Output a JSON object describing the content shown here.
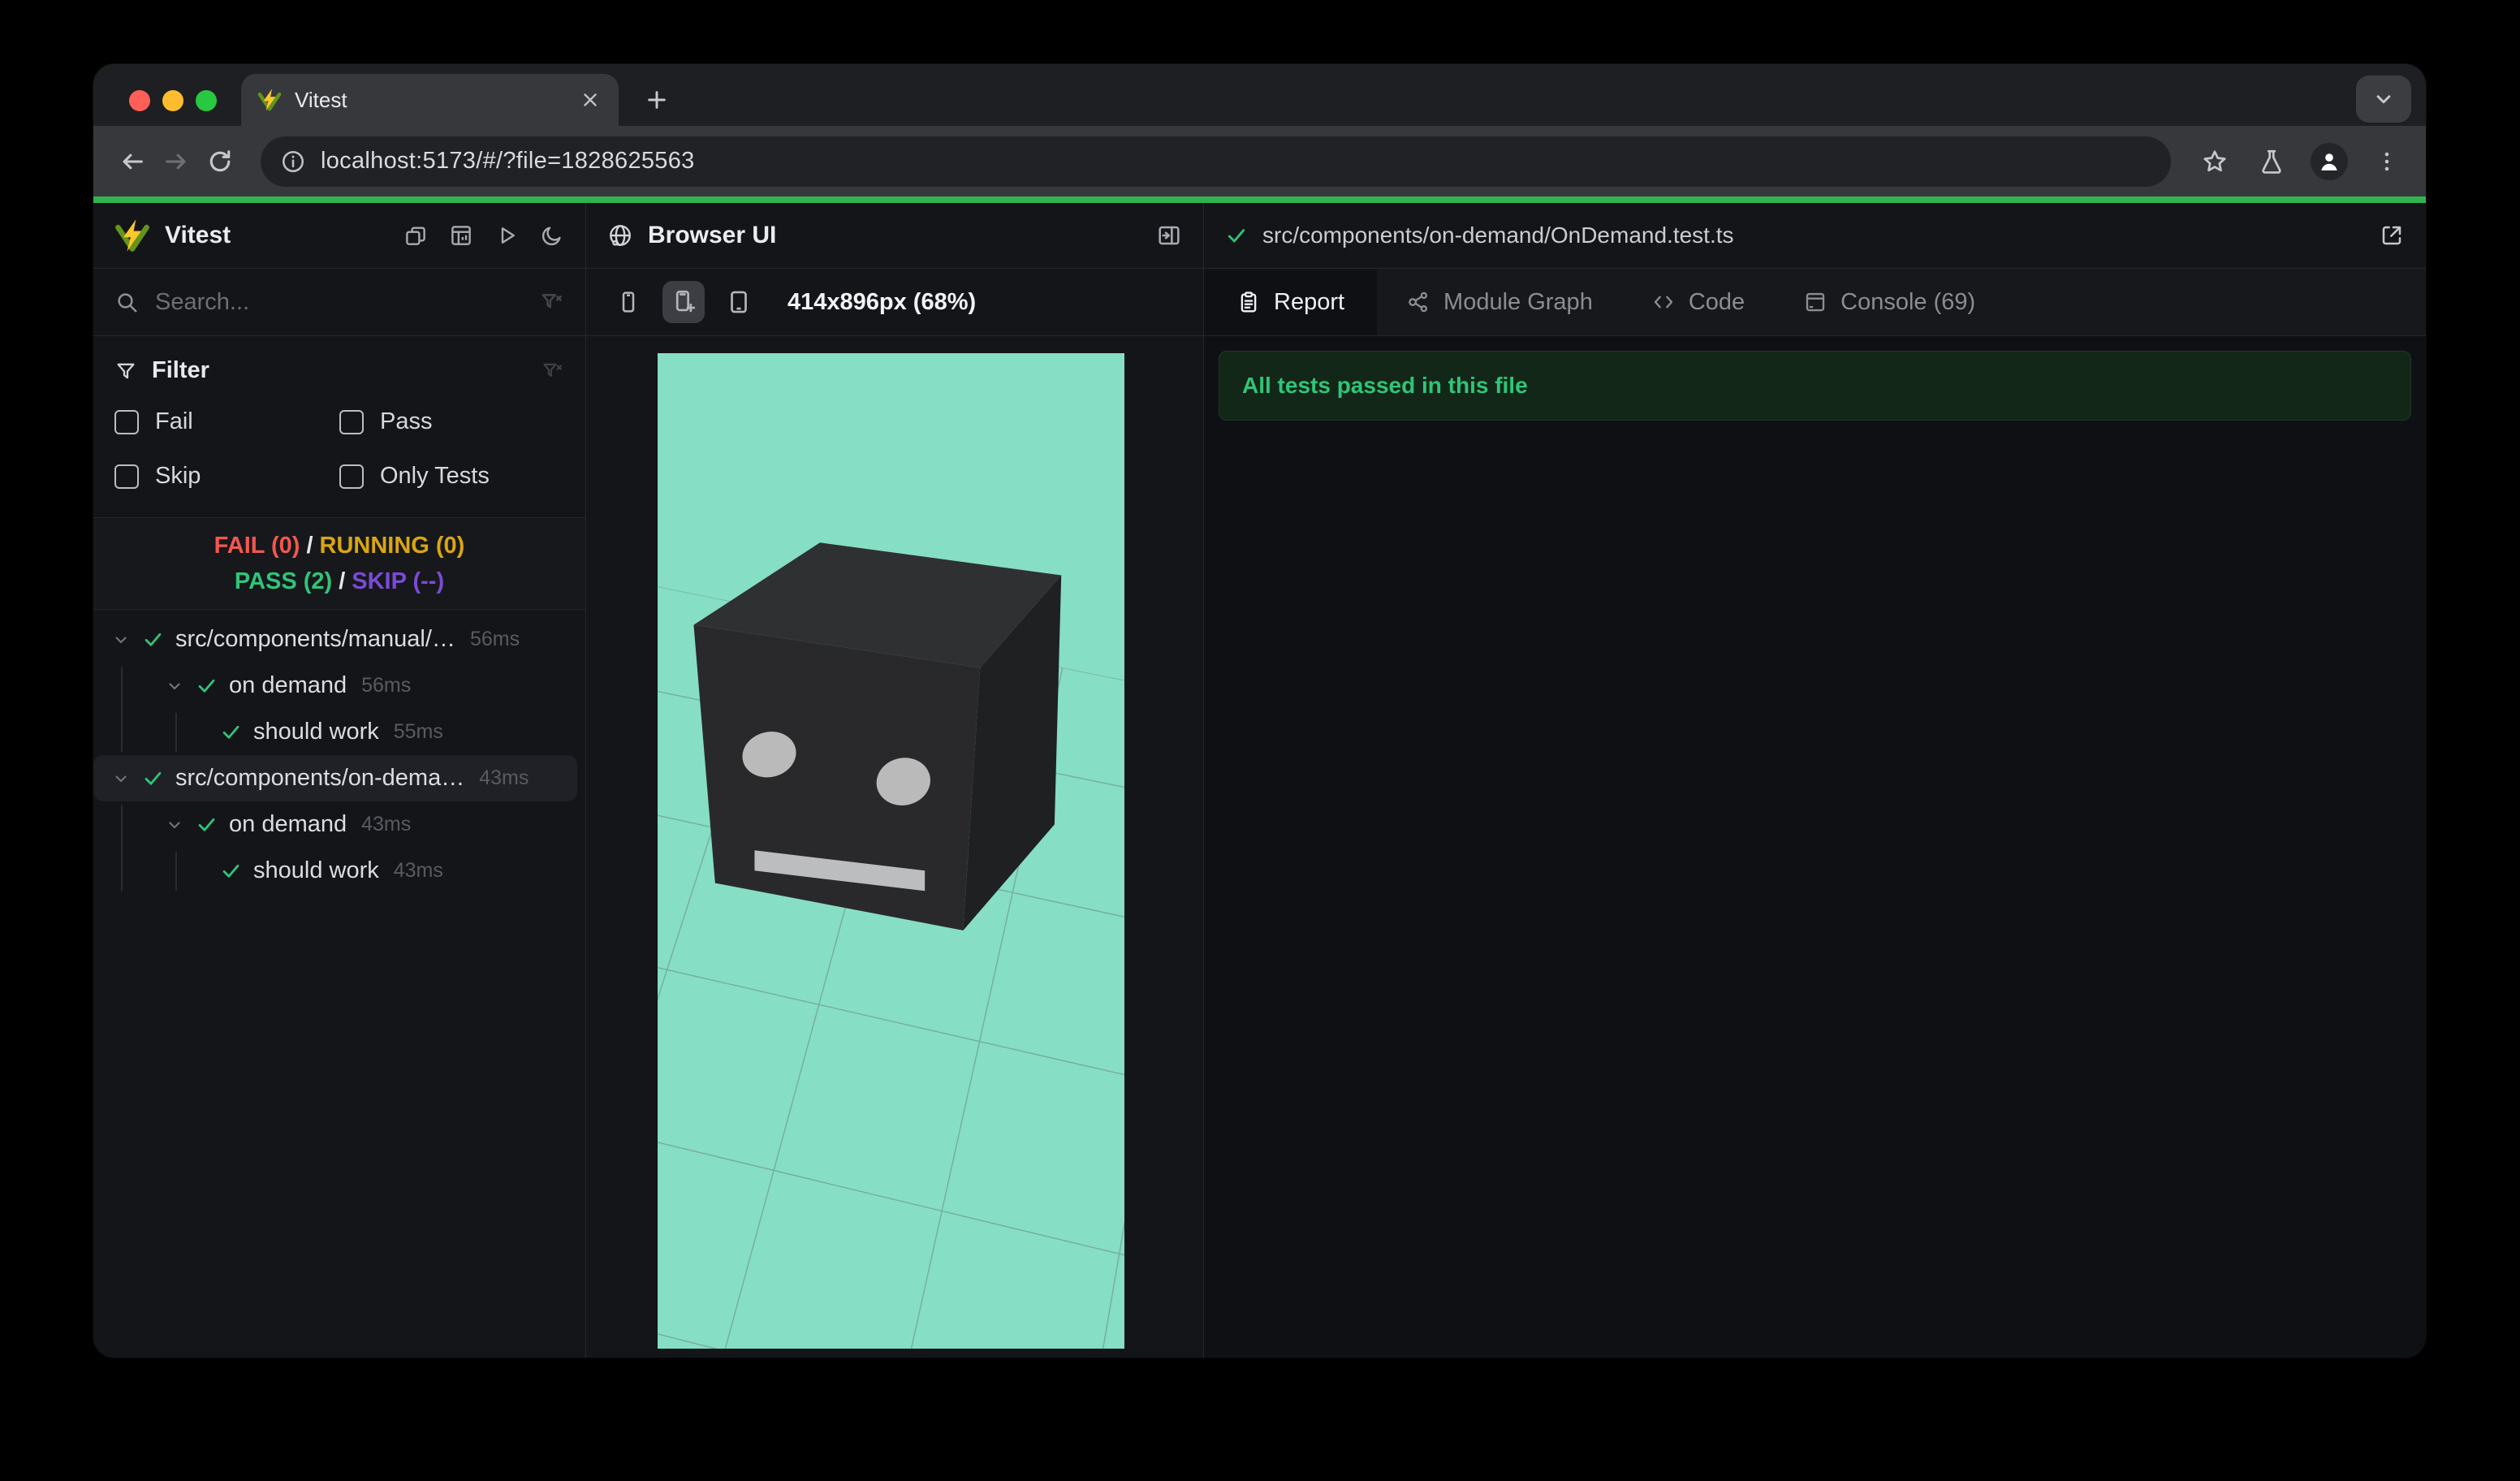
{
  "colors": {
    "accent-green": "#30b34e",
    "teal": "#86dec5",
    "fail": "#f2574f",
    "running": "#d9a614",
    "pass": "#31c478",
    "skip": "#7a4bd6"
  },
  "browser": {
    "tab_title": "Vitest",
    "url": "localhost:5173/#/?file=1828625563"
  },
  "sidebar": {
    "title": "Vitest",
    "search_placeholder": "Search...",
    "filter": {
      "label": "Filter",
      "options": [
        {
          "label": "Fail"
        },
        {
          "label": "Pass"
        },
        {
          "label": "Skip"
        },
        {
          "label": "Only Tests"
        }
      ]
    },
    "status": {
      "fail": "FAIL (0)",
      "running": "RUNNING (0)",
      "pass": "PASS (2)",
      "skip": "SKIP (--)",
      "sep": "/"
    },
    "tree": [
      {
        "label": "src/components/manual/…",
        "duration": "56ms"
      },
      {
        "label": "on demand",
        "duration": "56ms"
      },
      {
        "label": "should work",
        "duration": "55ms"
      },
      {
        "label": "src/components/on-dema…",
        "duration": "43ms"
      },
      {
        "label": "on demand",
        "duration": "43ms"
      },
      {
        "label": "should work",
        "duration": "43ms"
      }
    ]
  },
  "browser_panel": {
    "title": "Browser UI",
    "viewport": "414x896px (68%)"
  },
  "report_panel": {
    "file": "src/components/on-demand/OnDemand.test.ts",
    "tabs": [
      {
        "label": "Report"
      },
      {
        "label": "Module Graph"
      },
      {
        "label": "Code"
      },
      {
        "label": "Console (69)"
      }
    ],
    "banner": "All tests passed in this file"
  }
}
